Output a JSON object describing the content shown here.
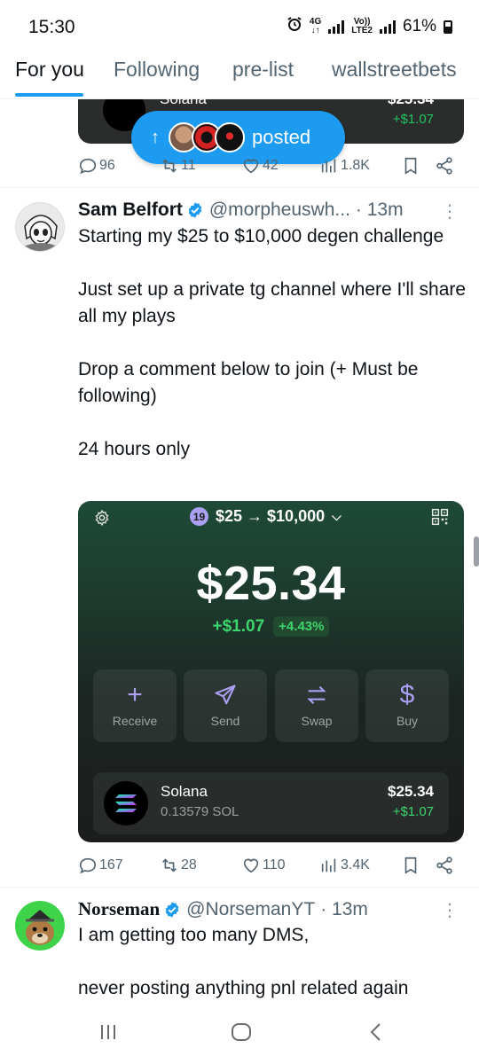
{
  "status_bar": {
    "time": "15:30",
    "network_top": "4G",
    "network_label": "LTE2",
    "volte": "Vo))",
    "battery": "61%"
  },
  "tabs": [
    {
      "label": "For you",
      "active": true
    },
    {
      "label": "Following",
      "active": false
    },
    {
      "label": "pre-list",
      "active": false
    },
    {
      "label": "wallstreetbets",
      "active": false
    }
  ],
  "top_card": {
    "token_name": "Solana",
    "value": "$25.34",
    "change": "+$1.07"
  },
  "posted_pill": {
    "label": "posted"
  },
  "top_actions": {
    "replies": "96",
    "reposts": "11",
    "likes": "42",
    "views": "1.8K"
  },
  "tweet1": {
    "name": "Sam Belfort",
    "handle": "@morpheuswh...",
    "time": "· 13m",
    "paragraphs": [
      "Starting my $25 to $10,000 degen challenge",
      "Just set up a private tg channel where I'll share all my plays",
      "Drop a comment below to join (+ Must be following)",
      "24 hours only"
    ],
    "wallet": {
      "account_number": "19",
      "account_name": "$25 → $10,000",
      "total": "$25.34",
      "change_abs": "+$1.07",
      "change_pct": "+4.43%",
      "buttons": {
        "receive": "Receive",
        "send": "Send",
        "swap": "Swap",
        "buy": "Buy"
      },
      "token": {
        "name": "Solana",
        "amount": "0.13579 SOL",
        "value": "$25.34",
        "change": "+$1.07"
      }
    },
    "actions": {
      "replies": "167",
      "reposts": "28",
      "likes": "110",
      "views": "3.4K"
    }
  },
  "tweet2": {
    "name": "Norseman",
    "handle": "@NorsemanYT",
    "time": "· 13m",
    "paragraphs": [
      "I am getting too many DMS,",
      "never posting anything pnl related again"
    ]
  },
  "colors": {
    "accent": "#1d9bf0",
    "wallet_green": "#3dd56d",
    "wallet_purple": "#ab9ff2"
  }
}
